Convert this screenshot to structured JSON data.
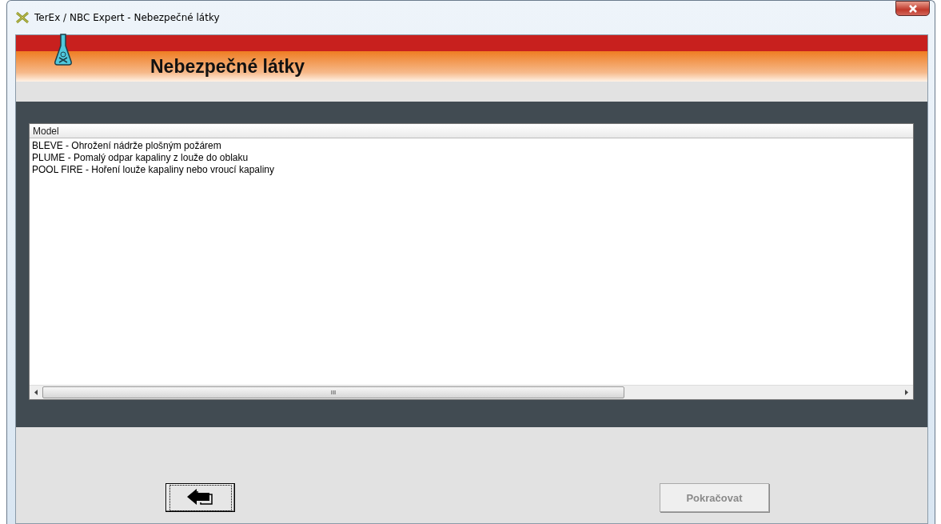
{
  "window": {
    "title": "TerEx / NBC Expert  - Nebezpečné látky"
  },
  "banner": {
    "title": "Nebezpečné látky"
  },
  "list": {
    "columns": [
      "Model"
    ],
    "rows": [
      {
        "text": "BLEVE - Ohrožení nádrže plošným požárem",
        "selected": false
      },
      {
        "text": "PLUME - Pomalý odpar kapaliny z louže do oblaku",
        "selected": false
      },
      {
        "text": "POOL FIRE - Hoření louže kapaliny nebo vroucí kapaliny",
        "selected": false
      }
    ],
    "scroll_thumb": "III"
  },
  "buttons": [
    {
      "kind": "back",
      "focused": true,
      "disabled": false
    },
    {
      "kind": "text",
      "label": "Pokračovat",
      "focused": false,
      "disabled": true
    }
  ]
}
